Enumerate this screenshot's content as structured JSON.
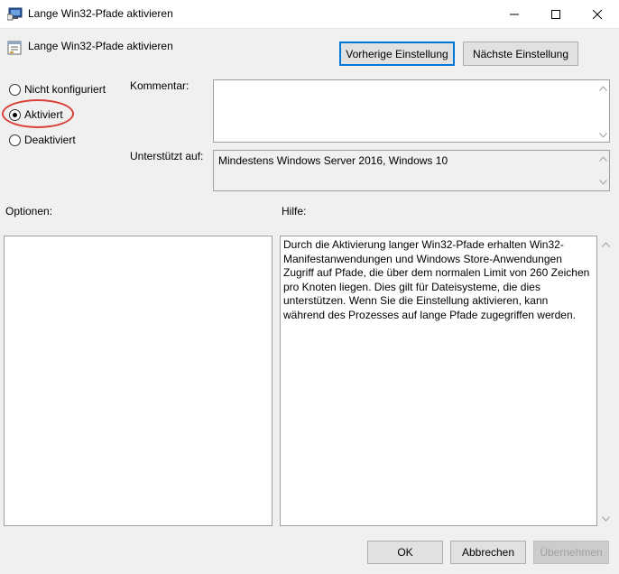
{
  "window": {
    "title": "Lange Win32-Pfade aktivieren",
    "icon": "policy-editor-icon"
  },
  "policy": {
    "title": "Lange Win32-Pfade aktivieren",
    "icon": "policy-setting-icon"
  },
  "nav": {
    "previous_label": "Vorherige Einstellung",
    "next_label": "Nächste Einstellung"
  },
  "state": {
    "options": [
      {
        "label": "Nicht konfiguriert",
        "selected": false
      },
      {
        "label": "Aktiviert",
        "selected": true
      },
      {
        "label": "Deaktiviert",
        "selected": false
      }
    ],
    "highlight_color": "#d9413a"
  },
  "comment": {
    "label": "Kommentar:",
    "value": ""
  },
  "supported": {
    "label": "Unterstützt auf:",
    "value": "Mindestens Windows Server 2016, Windows 10"
  },
  "options_panel": {
    "label": "Optionen:"
  },
  "help_panel": {
    "label": "Hilfe:",
    "text": "Durch die Aktivierung langer Win32-Pfade erhalten Win32-Manifestanwendungen und Windows Store-Anwendungen Zugriff auf Pfade, die über dem normalen Limit von 260 Zeichen pro Knoten liegen. Dies gilt für Dateisysteme, die dies unterstützen. Wenn Sie die Einstellung aktivieren, kann während des Prozesses auf lange Pfade zugegriffen werden."
  },
  "footer": {
    "ok_label": "OK",
    "cancel_label": "Abbrechen",
    "apply_label": "Übernehmen"
  },
  "colors": {
    "focus_border": "#0078d7",
    "window_bg": "#f0f0f0"
  }
}
